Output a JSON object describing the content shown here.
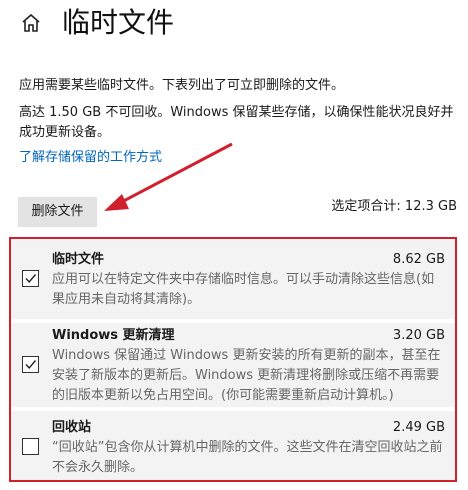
{
  "header": {
    "title": "临时文件"
  },
  "description": {
    "line1": "应用需要某些临时文件。下表列出了可立即删除的文件。",
    "line2": "高达 1.50 GB 不可回收。Windows 保留某些存储，以确保性能状况良好并成功更新设备。"
  },
  "link": "了解存储保留的工作方式",
  "toolbar": {
    "delete_label": "删除文件",
    "selected_total": "选定项合计: 12.3 GB"
  },
  "items": [
    {
      "title": "临时文件",
      "size": "8.62 GB",
      "description": "应用可以在特定文件夹中存储临时信息。可以手动清除这些信息(如果应用未自动将其清除)。",
      "checked": true
    },
    {
      "title": "Windows 更新清理",
      "size": "3.20 GB",
      "description": "Windows 保留通过 Windows 更新安装的所有更新的副本，甚至在安装了新版本的更新后。Windows 更新清理将删除或压缩不再需要的旧版本更新以免占用空间。(你可能需要重新启动计算机。)",
      "checked": true
    },
    {
      "title": "回收站",
      "size": "2.49 GB",
      "description": "“回收站”包含你从计算机中删除的文件。这些文件在清空回收站之前不会永久删除。",
      "checked": false
    }
  ],
  "colors": {
    "accent_link": "#0067c0",
    "highlight_border": "#d0202e",
    "arrow": "#d0202e"
  }
}
